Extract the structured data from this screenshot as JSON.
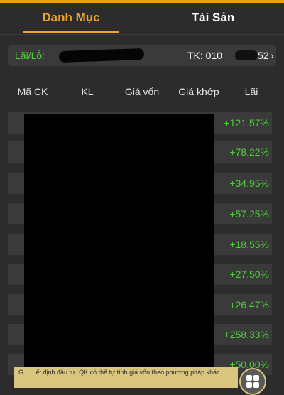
{
  "tabs": [
    {
      "label": "Danh Mục",
      "active": true
    },
    {
      "label": "Tài Sản",
      "active": false
    }
  ],
  "summary": {
    "pnl_label": "Lãi/Lỗ:",
    "account_label": "TK: 010",
    "account_suffix": "52",
    "chevron": "›"
  },
  "table": {
    "headers": [
      "Mã CK",
      "KL",
      "Giá vốn",
      "Giá khớp",
      "Lãi"
    ],
    "rows": [
      {
        "profit": "+121.57%"
      },
      {
        "profit": "+78.22%"
      },
      {
        "profit": "+34.95%"
      },
      {
        "profit": "+57.25%"
      },
      {
        "profit": "+18.55%"
      },
      {
        "profit": "+27.50%"
      },
      {
        "profit": "+26.47%"
      },
      {
        "profit": "+258.33%"
      },
      {
        "profit": "+50.00%"
      }
    ]
  },
  "footer": {
    "note": "G... ...ết định đầu tư. QK có thể tự tính giá vốn theo phương pháp khác",
    "menu_icon": "grid-icon"
  },
  "colors": {
    "accent": "#f1a32b",
    "profit": "#4cd137",
    "background": "#2c2c2c"
  }
}
